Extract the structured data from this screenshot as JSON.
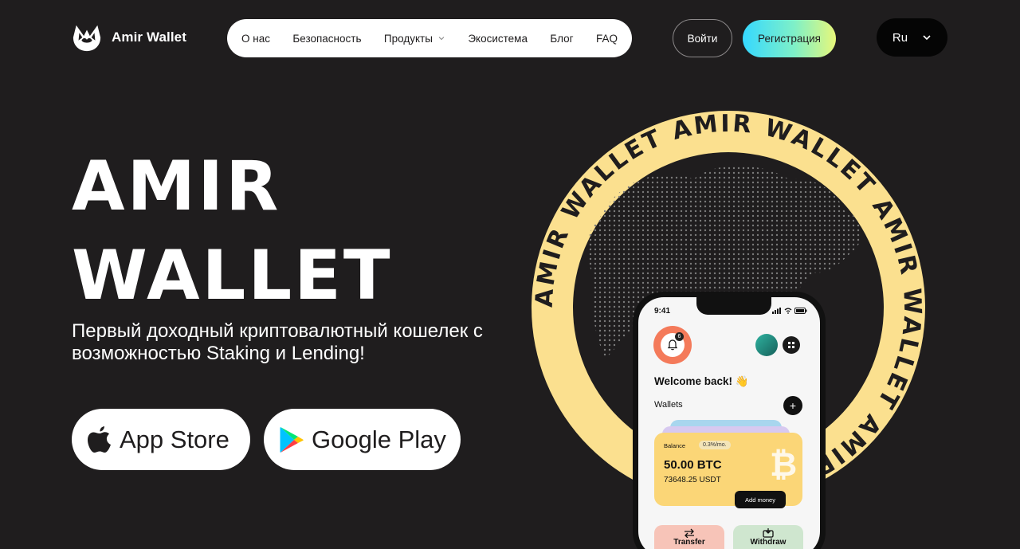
{
  "brand": {
    "name": "Amir Wallet"
  },
  "nav": {
    "items": [
      {
        "label": "О нас"
      },
      {
        "label": "Безопасность"
      },
      {
        "label": "Продукты",
        "has_dropdown": true
      },
      {
        "label": "Экосистема"
      },
      {
        "label": "Блог"
      },
      {
        "label": "FAQ"
      }
    ]
  },
  "header": {
    "login_label": "Войти",
    "register_label": "Регистрация",
    "language": "Ru"
  },
  "hero": {
    "title_line1": "AMIR",
    "title_line2": "WALLET",
    "subtitle": "Первый доходный криптовалютный кошелек с возможностью Staking и Lending!",
    "app_store_label": "App Store",
    "google_play_label": "Google Play"
  },
  "badge": {
    "ring_text": "AMIR WALLET AMIR WALLET AMIR WALLET AMIR WALLET"
  },
  "phone": {
    "time": "9:41",
    "notification_count": "6",
    "welcome": "Welcome back! 👋",
    "wallets_label": "Wallets",
    "card": {
      "balance_label": "Balance",
      "rate": "0.3%/mo.",
      "btc": "50.00 BTC",
      "usdt": "73648.25 USDT",
      "add_money": "Add money"
    },
    "actions": {
      "transfer": "Transfer",
      "withdraw": "Withdraw"
    }
  },
  "colors": {
    "background": "#1f1d1e",
    "ring": "#fbe08f",
    "register_gradient": [
      "#35d8ff",
      "#7ef0c8",
      "#e7f77a"
    ]
  }
}
